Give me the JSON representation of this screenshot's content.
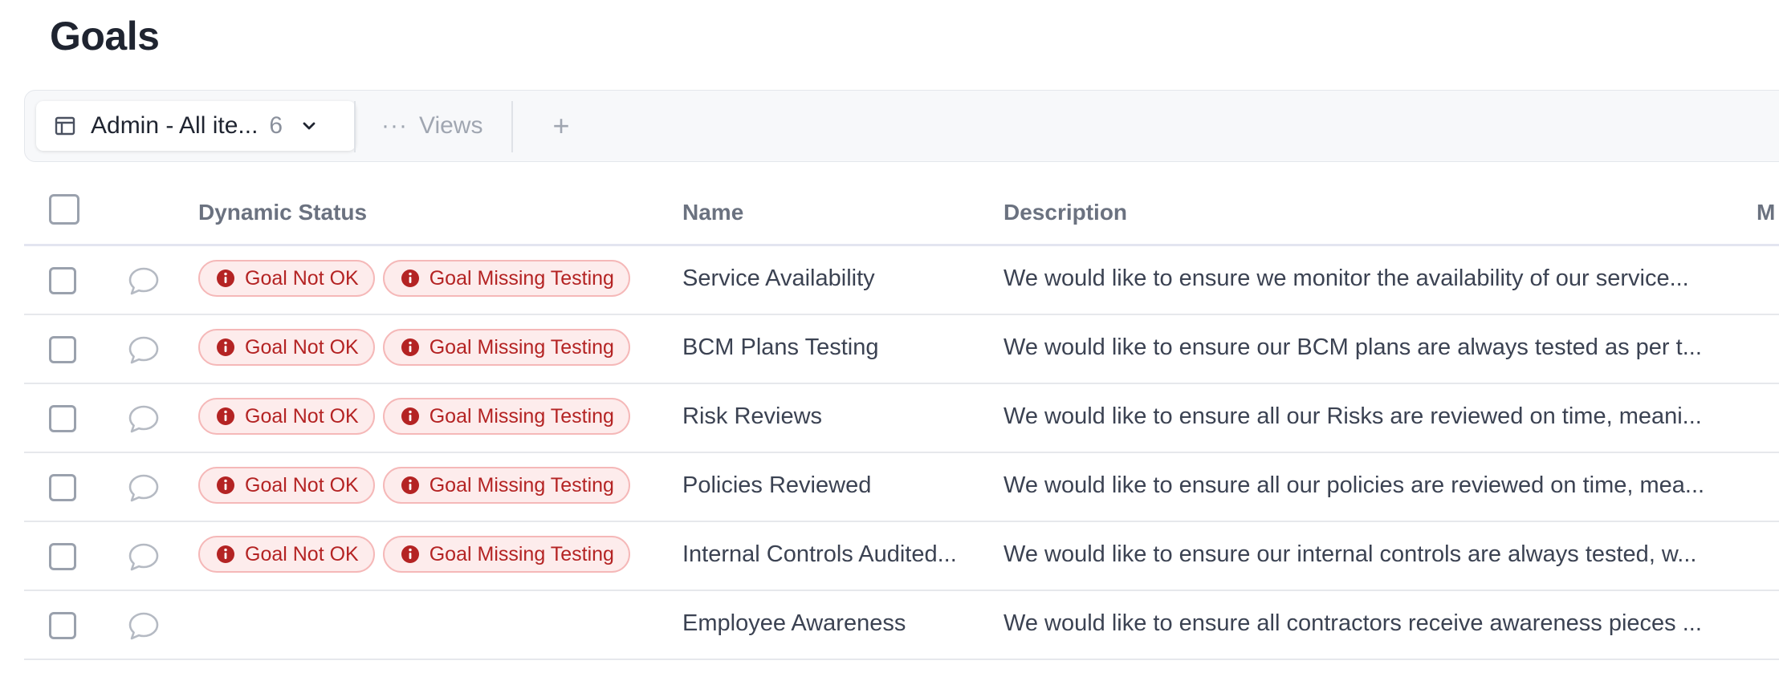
{
  "page": {
    "title": "Goals"
  },
  "toolbar": {
    "view_name": "Admin - All ite...",
    "view_count": "6",
    "views_dots": "···",
    "views_label": "Views",
    "add_label": "+"
  },
  "table": {
    "headers": {
      "dynamic_status": "Dynamic Status",
      "name": "Name",
      "description": "Description",
      "next": "M"
    },
    "rows": [
      {
        "statuses": [
          "Goal Not OK",
          "Goal Missing Testing"
        ],
        "name": "Service Availability",
        "description": "We would like to ensure we monitor the availability of our service..."
      },
      {
        "statuses": [
          "Goal Not OK",
          "Goal Missing Testing"
        ],
        "name": "BCM Plans Testing",
        "description": "We would like to ensure our BCM plans are always tested as per t..."
      },
      {
        "statuses": [
          "Goal Not OK",
          "Goal Missing Testing"
        ],
        "name": "Risk Reviews",
        "description": "We would like to ensure all our Risks are reviewed on time, meani..."
      },
      {
        "statuses": [
          "Goal Not OK",
          "Goal Missing Testing"
        ],
        "name": "Policies Reviewed",
        "description": "We would like to ensure all our policies are reviewed on time, mea..."
      },
      {
        "statuses": [
          "Goal Not OK",
          "Goal Missing Testing"
        ],
        "name": "Internal Controls Audited...",
        "description": "We would like to ensure our internal controls are always tested, w..."
      },
      {
        "statuses": [],
        "name": "Employee Awareness",
        "description": "We would like to ensure all contractors receive awareness pieces ..."
      }
    ]
  },
  "colors": {
    "badge_bg": "#fdecec",
    "badge_border": "#f5b8b8",
    "badge_text": "#b42323"
  },
  "icons": {
    "view": "table-icon",
    "dropdown": "chevron-down-icon",
    "comment": "comment-icon",
    "status": "info-icon"
  }
}
